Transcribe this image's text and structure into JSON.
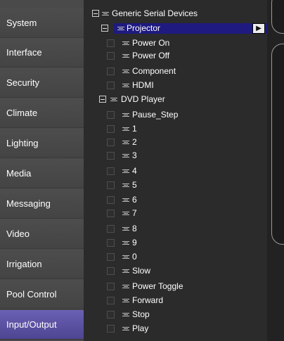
{
  "sidebar": {
    "items": [
      {
        "label": "System"
      },
      {
        "label": "Interface"
      },
      {
        "label": "Security"
      },
      {
        "label": "Climate"
      },
      {
        "label": "Lighting"
      },
      {
        "label": "Media"
      },
      {
        "label": "Messaging"
      },
      {
        "label": "Video"
      },
      {
        "label": "Irrigation"
      },
      {
        "label": "Pool Control"
      },
      {
        "label": "Input/Output",
        "selected": true
      }
    ]
  },
  "tree": {
    "root_label": "Generic Serial Devices",
    "projector": {
      "label": "Projector",
      "children": [
        "Power On",
        "Power Off",
        "Component",
        "HDMI"
      ]
    },
    "dvd": {
      "label": "DVD Player",
      "children": [
        "Pause_Step",
        "1",
        "2",
        "3",
        "4",
        "5",
        "6",
        "7",
        "8",
        "9",
        "0",
        "Slow",
        "Power Toggle",
        "Forward",
        "Stop",
        "Play"
      ]
    },
    "play_button_icon": "play-triangle-icon"
  },
  "colors": {
    "sidebar_bg": "#4a4a4a",
    "sidebar_selected": "#5b52a3",
    "tree_bg": "#2b2b2b",
    "tree_selection": "#1e1a80"
  }
}
